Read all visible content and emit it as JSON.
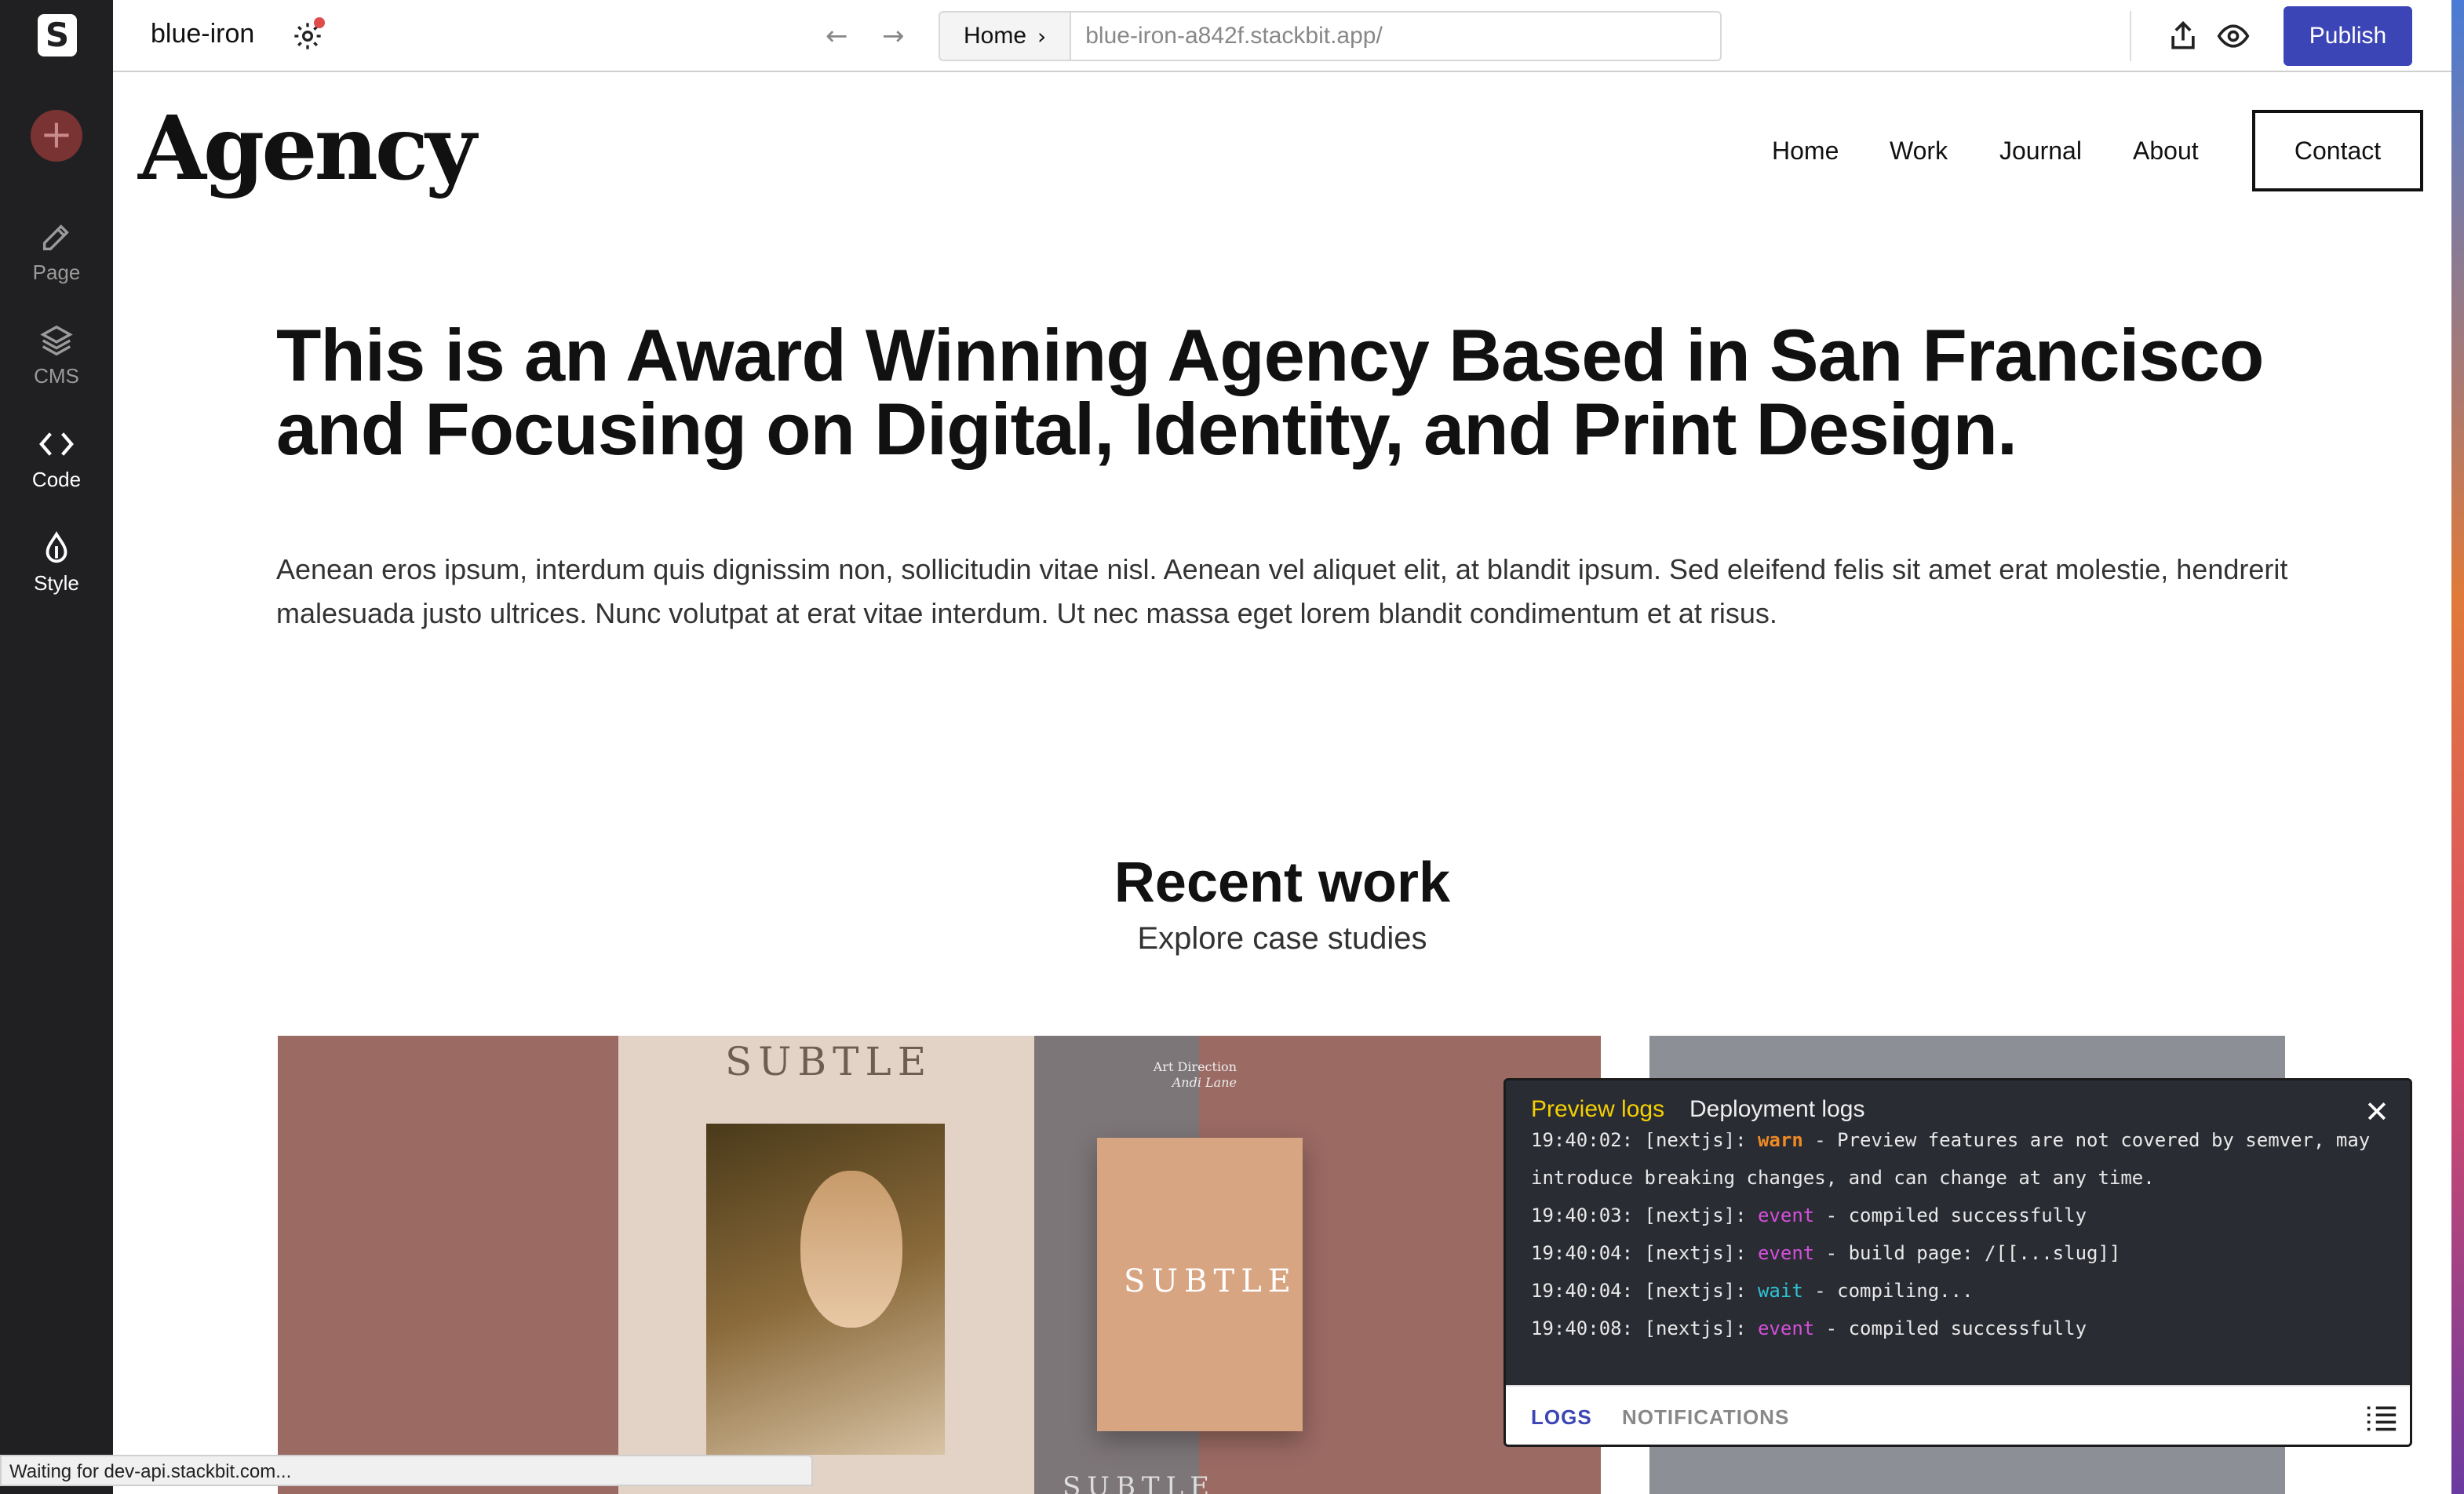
{
  "app": {
    "logo_letter": "S",
    "site_name": "blue-iron",
    "url_crumb": "Home",
    "url": "blue-iron-a842f.stackbit.app/",
    "publish_label": "Publish"
  },
  "sidebar": {
    "items": [
      {
        "label": "Page",
        "icon": "pencil-icon"
      },
      {
        "label": "CMS",
        "icon": "layers-icon"
      },
      {
        "label": "Code",
        "icon": "code-icon"
      },
      {
        "label": "Style",
        "icon": "drop-icon"
      }
    ]
  },
  "site": {
    "brand": "Agency",
    "nav": [
      "Home",
      "Work",
      "Journal",
      "About"
    ],
    "contact": "Contact",
    "hero_title": "This is an Award Winning Agency Based in San Francisco and Focusing on Digital, Identity, and Print Design.",
    "hero_text": "Aenean eros ipsum, interdum quis dignissim non, sollicitudin vitae nisl. Aenean vel aliquet elit, at blandit ipsum. Sed eleifend felis sit amet erat molestie, hendrerit malesuada justo ultrices. Nunc volutpat at erat vitae interdum. Ut nec massa eget lorem blandit condimentum et at risus.",
    "recent_title": "Recent work",
    "recent_sub": "Explore case studies",
    "card_text_1": "SUBTLE",
    "card_text_2": "SUBTLE",
    "card_text_3": "SUBTLE",
    "card_credit_1": "Art Direction",
    "card_credit_2": "Andi Lane"
  },
  "logs": {
    "tab_preview": "Preview logs",
    "tab_deploy": "Deployment logs",
    "lines": [
      {
        "time": "19:40:02: [nextjs]: ",
        "kind": "warn",
        "msg": " - Preview features are not covered by semver, may"
      },
      {
        "time": "",
        "kind": "",
        "msg": "introduce breaking changes, and can change at any time."
      },
      {
        "time": "19:40:03: [nextjs]: ",
        "kind": "event",
        "msg": " - compiled successfully"
      },
      {
        "time": "19:40:04: [nextjs]: ",
        "kind": "event",
        "msg": " - build page: /[[...slug]]"
      },
      {
        "time": "19:40:04: [nextjs]: ",
        "kind": "wait",
        "msg": " - compiling..."
      },
      {
        "time": "19:40:08: [nextjs]: ",
        "kind": "event",
        "msg": " - compiled successfully"
      }
    ],
    "foot_logs": "LOGS",
    "foot_notifications": "NOTIFICATIONS"
  },
  "status_text": "Waiting for dev-api.stackbit.com...",
  "colors": {
    "accent": "#3c45b5",
    "sidebar_bg": "#202022",
    "log_active_tab": "#f5d000",
    "warn": "#f08a24",
    "event": "#d24fd8",
    "wait": "#2fc3d3"
  }
}
